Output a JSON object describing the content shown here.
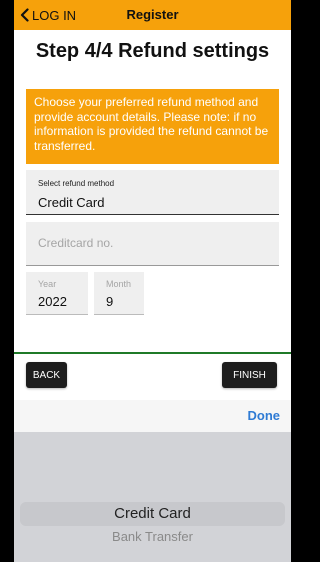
{
  "header": {
    "back_label": "LOG IN",
    "title": "Register"
  },
  "step_title": "Step 4/4 Refund settings",
  "notice": "Choose your preferred refund method and provide account details. Please note: if no information is provided the refund cannot be transferred.",
  "refund_method": {
    "label": "Select refund method",
    "value": "Credit Card"
  },
  "card_number": {
    "placeholder": "Creditcard no."
  },
  "expiry": {
    "year_label": "Year",
    "year_value": "2022",
    "month_label": "Month",
    "month_value": "9"
  },
  "actions": {
    "back_label": "BACK",
    "finish_label": "FINISH"
  },
  "picker": {
    "done_label": "Done",
    "options": [
      "Credit Card",
      "Bank Transfer"
    ],
    "selected": "Credit Card"
  },
  "colors": {
    "accent": "#f6a10b",
    "divider_green": "#1f7a28",
    "done_blue": "#2f7bd4"
  }
}
